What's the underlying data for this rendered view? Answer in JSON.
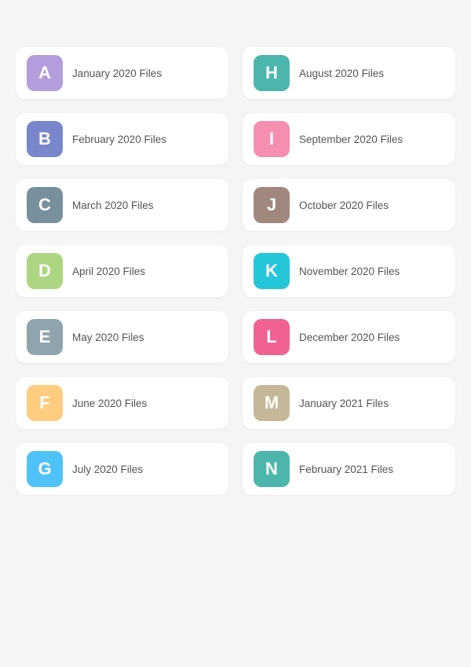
{
  "folders": [
    {
      "letter": "A",
      "label": "January 2020 Files",
      "color": "#b39ddb"
    },
    {
      "letter": "H",
      "label": "August 2020 Files",
      "color": "#4db6ac"
    },
    {
      "letter": "B",
      "label": "February 2020 Files",
      "color": "#7986cb"
    },
    {
      "letter": "I",
      "label": "September 2020 Files",
      "color": "#f48fb1"
    },
    {
      "letter": "C",
      "label": "March 2020 Files",
      "color": "#78909c"
    },
    {
      "letter": "J",
      "label": "October 2020 Files",
      "color": "#a1887f"
    },
    {
      "letter": "D",
      "label": "April 2020 Files",
      "color": "#aed581"
    },
    {
      "letter": "K",
      "label": "November 2020 Files",
      "color": "#26c6da"
    },
    {
      "letter": "E",
      "label": "May 2020 Files",
      "color": "#90a4ae"
    },
    {
      "letter": "L",
      "label": "December 2020 Files",
      "color": "#f06292"
    },
    {
      "letter": "F",
      "label": "June 2020 Files",
      "color": "#ffcc80"
    },
    {
      "letter": "M",
      "label": "January 2021 Files",
      "color": "#c5b899"
    },
    {
      "letter": "G",
      "label": "July 2020 Files",
      "color": "#4fc3f7"
    },
    {
      "letter": "N",
      "label": "February 2021 Files",
      "color": "#4db6ac"
    }
  ]
}
